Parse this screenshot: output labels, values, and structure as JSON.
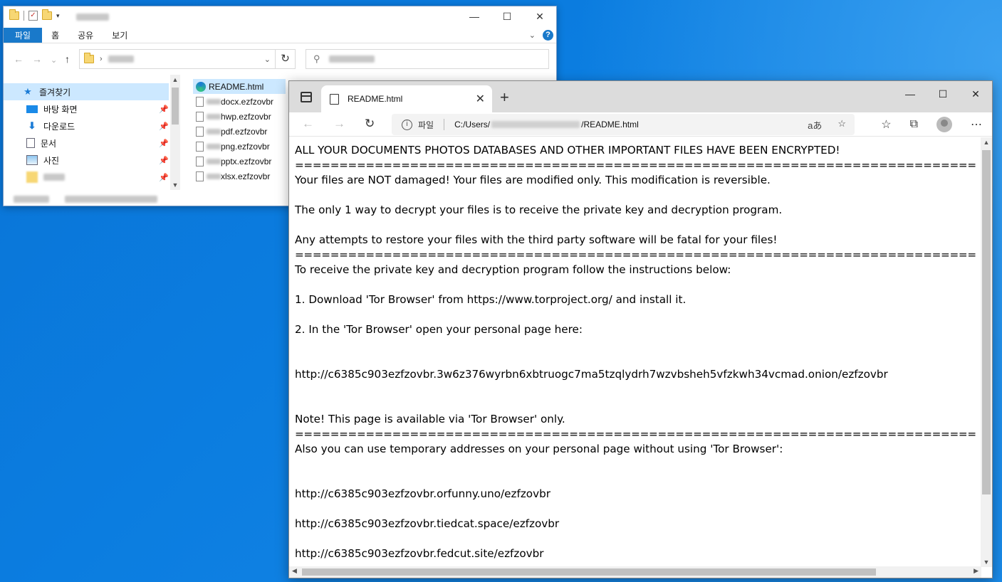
{
  "explorer": {
    "title_blurred": "",
    "ribbon_tabs": [
      "파일",
      "홈",
      "공유",
      "보기"
    ],
    "nav_items": [
      {
        "label": "즐겨찾기",
        "icon": "star-icon"
      },
      {
        "label": "바탕 화면",
        "icon": "desktop-icon"
      },
      {
        "label": "다운로드",
        "icon": "download-icon"
      },
      {
        "label": "문서",
        "icon": "document-icon"
      },
      {
        "label": "사진",
        "icon": "pictures-icon"
      }
    ],
    "files": [
      {
        "name": "README.html",
        "icon": "edge-icon",
        "selected": true
      },
      {
        "name": "docx.ezfzovbr",
        "icon": "file-icon"
      },
      {
        "name": "hwp.ezfzovbr",
        "icon": "file-icon"
      },
      {
        "name": "pdf.ezfzovbr",
        "icon": "file-icon"
      },
      {
        "name": "png.ezfzovbr",
        "icon": "file-icon"
      },
      {
        "name": "pptx.ezfzovbr",
        "icon": "file-icon"
      },
      {
        "name": "xlsx.ezfzovbr",
        "icon": "file-icon"
      }
    ]
  },
  "browser": {
    "tab_title": "README.html",
    "omnibox_label": "파일",
    "url_prefix": "C:/Users/",
    "url_suffix": "/README.html",
    "read_aloud_glyph": "aあ"
  },
  "note": {
    "separator": "==============================================================================================================",
    "lines": [
      "ALL YOUR DOCUMENTS PHOTOS DATABASES AND OTHER IMPORTANT FILES HAVE BEEN ENCRYPTED!",
      "Your files are NOT damaged! Your files are modified only. This modification is reversible.",
      "The only 1 way to decrypt your files is to receive the private key and decryption program.",
      "Any attempts to restore your files with the third party software will be fatal for your files!",
      "To receive the private key and decryption program follow the instructions below:",
      "1. Download 'Tor Browser' from https://www.torproject.org/ and install it.",
      "2. In the 'Tor Browser' open your personal page here:",
      "http://c6385c903ezfzovbr.3w6z376wyrbn6xbtruogc7ma5tzqlydrh7wzvbsheh5vfzkwh34vcmad.onion/ezfzovbr",
      "Note! This page is available via 'Tor Browser' only.",
      "Also you can use temporary addresses on your personal page without using 'Tor Browser':",
      "http://c6385c903ezfzovbr.orfunny.uno/ezfzovbr",
      "http://c6385c903ezfzovbr.tiedcat.space/ezfzovbr",
      "http://c6385c903ezfzovbr.fedcut.site/ezfzovbr"
    ]
  },
  "colors": {
    "desktop": "#0b7de0",
    "ribbon_active": "#1979ca",
    "selection": "#cce8ff"
  }
}
